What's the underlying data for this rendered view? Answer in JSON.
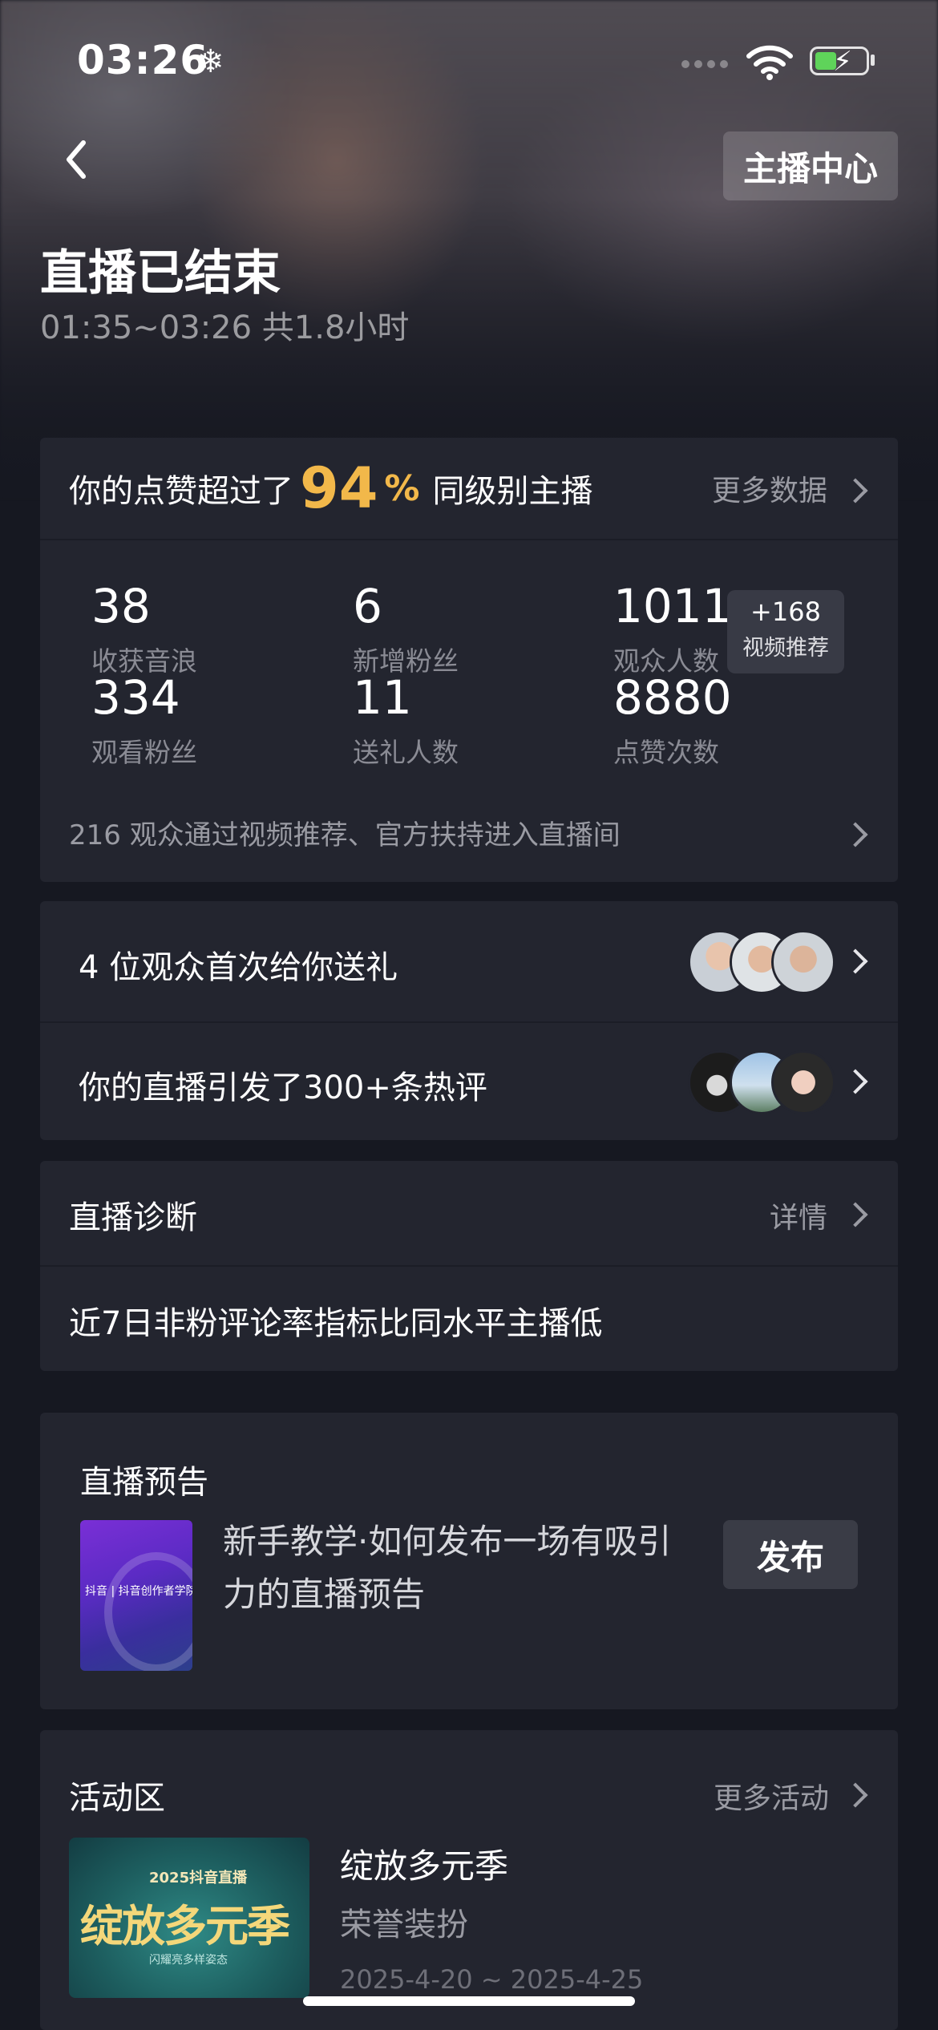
{
  "status_bar": {
    "time": "03:26",
    "extra_icon": "snowflake-icon"
  },
  "header": {
    "back_icon": "chevron-left-icon",
    "anchor_center_label": "主播中心",
    "title": "直播已结束",
    "time_range": "01:35~03:26 共1.8小时"
  },
  "summary": {
    "prefix": "你的点赞超过了",
    "percent": "94",
    "percent_sign": "%",
    "suffix": "同级别主播",
    "more_data": "更多数据",
    "stats": [
      {
        "value": "38",
        "label": "收获音浪"
      },
      {
        "value": "6",
        "label": "新增粉丝"
      },
      {
        "value": "1011",
        "label": "观众人数"
      },
      {
        "value": "334",
        "label": "观看粉丝"
      },
      {
        "value": "11",
        "label": "送礼人数"
      },
      {
        "value": "8880",
        "label": "点赞次数"
      }
    ],
    "boost": {
      "value": "+168",
      "label": "视频推荐"
    },
    "footnote": "216 观众通过视频推荐、官方扶持进入直播间"
  },
  "highlights": {
    "gift_row": "4 位观众首次给你送礼",
    "comment_row": "你的直播引发了300+条热评"
  },
  "diagnosis": {
    "title": "直播诊断",
    "detail_link": "详情",
    "message": "近7日非粉评论率指标比同水平主播低"
  },
  "preview": {
    "title": "直播预告",
    "tutorial": "新手教学·如何发布一场有吸引力的直播预告",
    "publish_label": "发布",
    "thumb_caption": "抖音 | 抖音创作者学院"
  },
  "activities": {
    "title": "活动区",
    "more_link": "更多活动",
    "item": {
      "name": "绽放多元季",
      "subtitle": "荣誉装扮",
      "dates": "2025-4-20 ~ 2025-4-25",
      "thumb_top": "2025抖音直播",
      "thumb_main": "绽放多元季",
      "thumb_sub": "闪耀亮多样姿态"
    }
  },
  "colors": {
    "background": "#161821",
    "card": "#23252f",
    "accent_gold": "#f2b84a",
    "muted_text": "#9a9ba3"
  }
}
